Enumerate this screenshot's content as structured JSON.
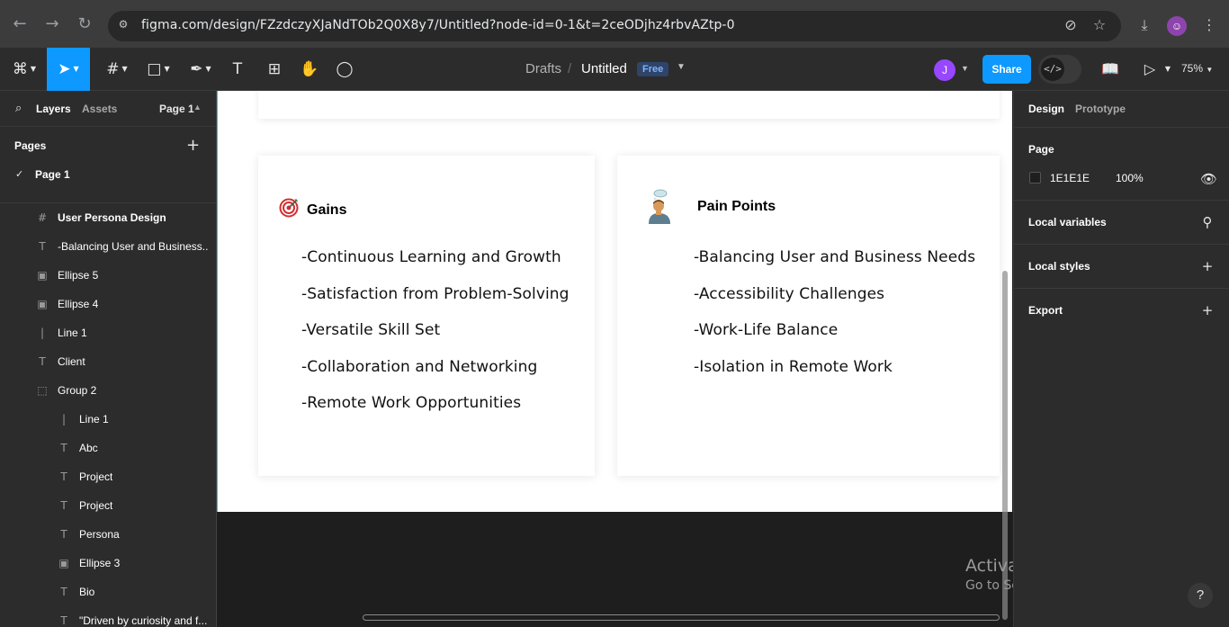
{
  "browser": {
    "url": "figma.com/design/FZzdczyXJaNdTOb2Q0X8y7/Untitled?node-id=0-1&t=2ceODjhz4rbvAZtp-0",
    "icons": [
      "back-icon",
      "forward-icon",
      "reload-icon",
      "site-info-icon",
      "cast-off-icon",
      "star-icon",
      "download-icon",
      "profile-icon",
      "menu-icon"
    ]
  },
  "toolbar": {
    "breadcrumb_drafts": "Drafts",
    "breadcrumb_sep": "/",
    "file_title": "Untitled",
    "plan_badge": "Free",
    "avatar_initial": "J",
    "share_label": "Share",
    "zoom": "75%",
    "accent": "#0d99ff"
  },
  "left_panel": {
    "tab_layers": "Layers",
    "tab_assets": "Assets",
    "page_select": "Page 1",
    "pages_header": "Pages",
    "current_page": "Page 1",
    "layers": [
      {
        "label": "User Persona Design",
        "icon": "frame-icon",
        "bold": true
      },
      {
        "label": "-Balancing User and Business...",
        "icon": "text-icon"
      },
      {
        "label": "Ellipse 5",
        "icon": "image-icon"
      },
      {
        "label": "Ellipse 4",
        "icon": "image-icon"
      },
      {
        "label": "Line 1",
        "icon": "line-icon"
      },
      {
        "label": "Client",
        "icon": "text-icon"
      },
      {
        "label": "Group 2",
        "icon": "group-icon"
      },
      {
        "label": "Line 1",
        "icon": "line-icon"
      },
      {
        "label": "Abc",
        "icon": "text-icon"
      },
      {
        "label": "Project",
        "icon": "text-icon"
      },
      {
        "label": "Project",
        "icon": "text-icon"
      },
      {
        "label": "Persona",
        "icon": "text-icon"
      },
      {
        "label": "Ellipse 3",
        "icon": "image-icon"
      },
      {
        "label": "Bio",
        "icon": "text-icon"
      },
      {
        "label": "\"Driven by curiosity and f...",
        "icon": "text-icon"
      }
    ]
  },
  "canvas": {
    "gains": {
      "title": "Gains",
      "items": [
        "-Continuous Learning and  Growth",
        "-Satisfaction from Problem-Solving",
        "-Versatile Skill Set",
        "-Collaboration and Networking",
        "-Remote Work Opportunities"
      ]
    },
    "pain_points": {
      "title": "Pain Points",
      "items": [
        "-Balancing User and Business Needs",
        "-Accessibility Challenges",
        "-Work-Life Balance",
        "-Isolation in Remote Work"
      ]
    }
  },
  "right_panel": {
    "tab_design": "Design",
    "tab_prototype": "Prototype",
    "page_section": "Page",
    "bg_hex": "1E1E1E",
    "bg_opacity": "100%",
    "local_variables": "Local variables",
    "local_styles": "Local styles",
    "export": "Export"
  },
  "watermark": {
    "line1": "Activate Windows",
    "line2": "Go to Settings to activate Windows."
  },
  "help": "?"
}
